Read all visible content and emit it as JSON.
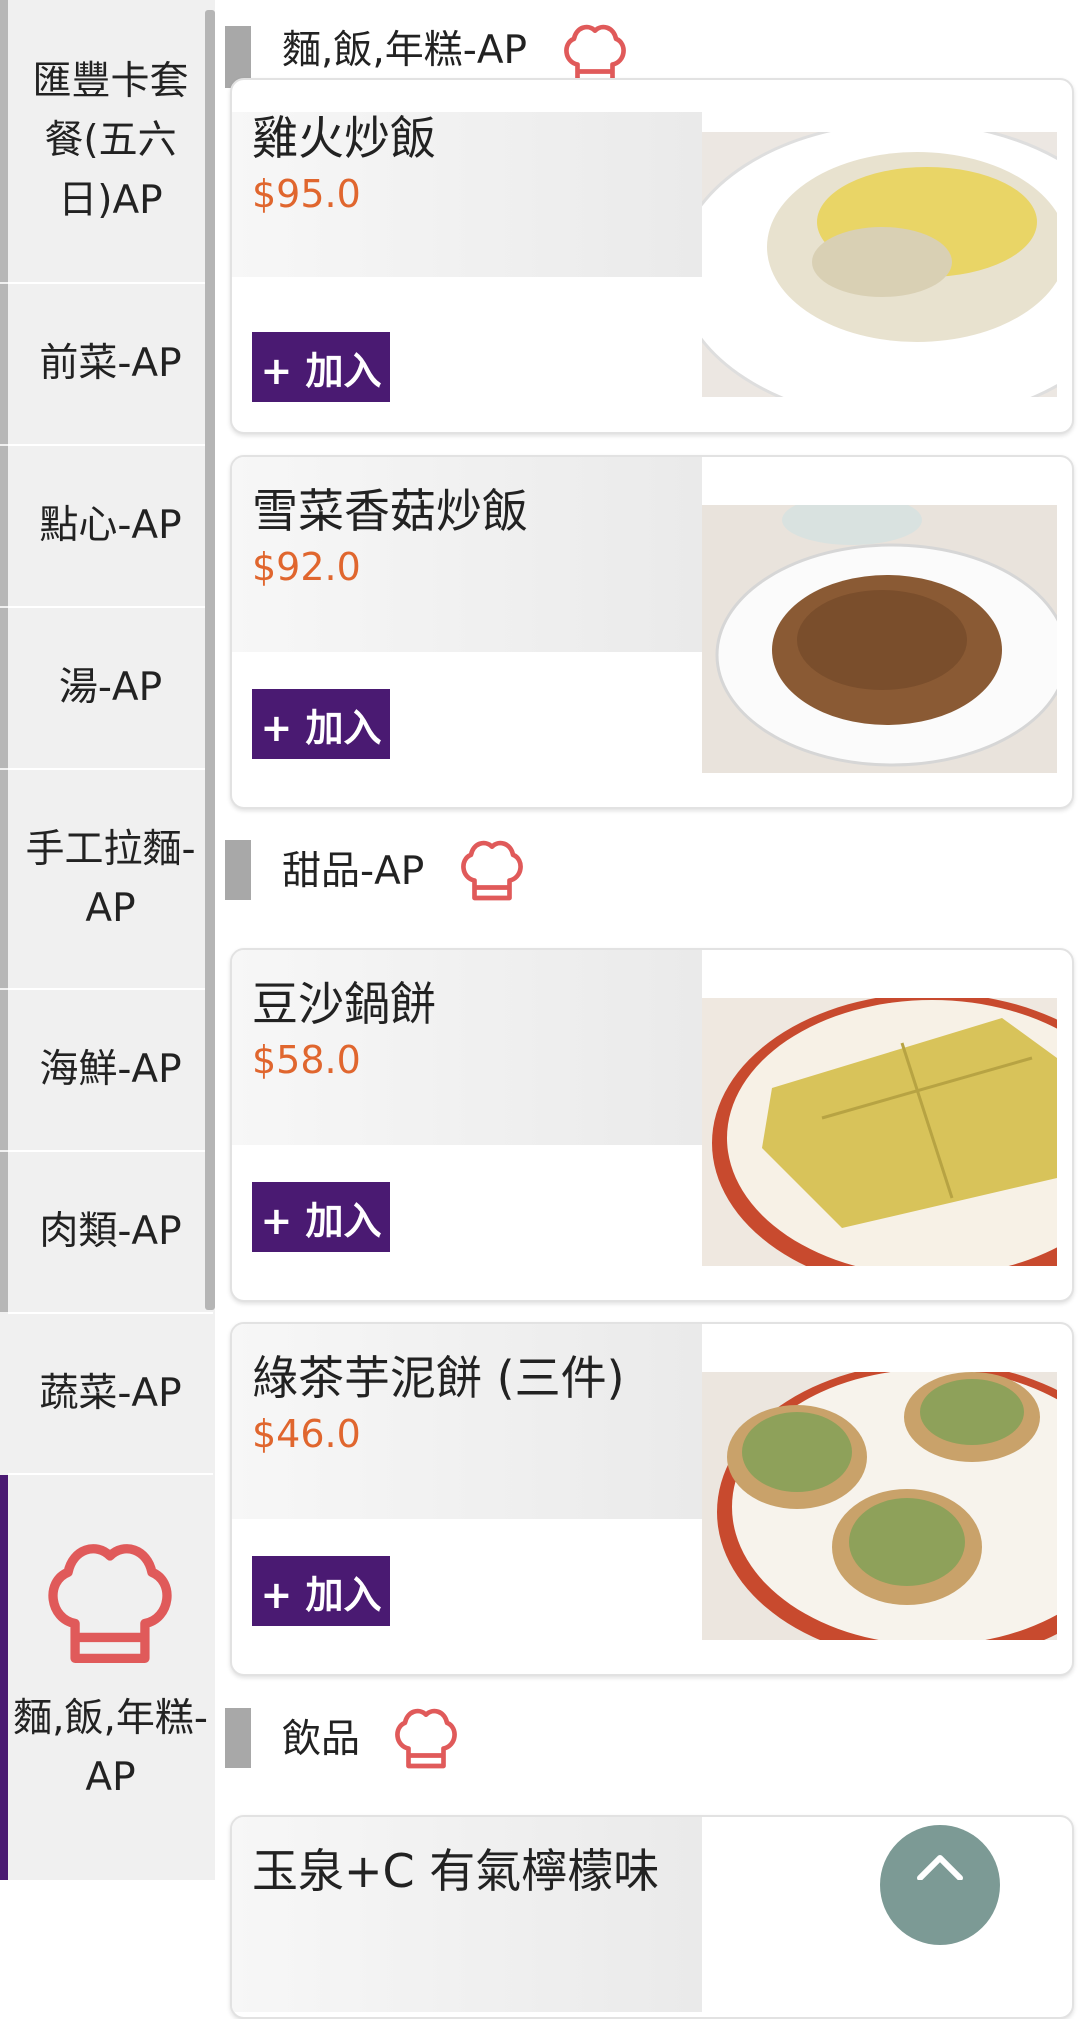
{
  "sidebar": {
    "items": [
      {
        "label": "匯豐卡套餐(五六日)AP"
      },
      {
        "label": "前菜-AP"
      },
      {
        "label": "點心-AP"
      },
      {
        "label": "湯-AP"
      },
      {
        "label": "手工拉麵-AP"
      },
      {
        "label": "海鮮-AP"
      },
      {
        "label": "肉類-AP"
      },
      {
        "label": "蔬菜-AP"
      }
    ],
    "active": {
      "label": "麵,飯,年糕-AP",
      "icon": "chef-hat-icon"
    }
  },
  "sections": [
    {
      "title": "麵,飯,年糕-AP",
      "icon": "chef-hat-icon"
    },
    {
      "title": "甜品-AP",
      "icon": "chef-hat-icon"
    },
    {
      "title": "飲品",
      "icon": "chef-hat-icon"
    }
  ],
  "dishes": [
    {
      "name": "雞火炒飯",
      "price": "$95.0",
      "add_label": "+ 加入"
    },
    {
      "name": "雪菜香菇炒飯",
      "price": "$92.0",
      "add_label": "+ 加入"
    },
    {
      "name": "豆沙鍋餅",
      "price": "$58.0",
      "add_label": "+ 加入"
    },
    {
      "name": "綠茶芋泥餅 (三件)",
      "price": "$46.0",
      "add_label": "+ 加入"
    },
    {
      "name": "玉泉+C 有氣檸檬味"
    }
  ],
  "colors": {
    "accent": "#4a1a72",
    "price": "#e0662e",
    "hat": "#e05a5a",
    "fab": "#7c9a95"
  },
  "scroll_top_icon": "chevron-up-icon"
}
